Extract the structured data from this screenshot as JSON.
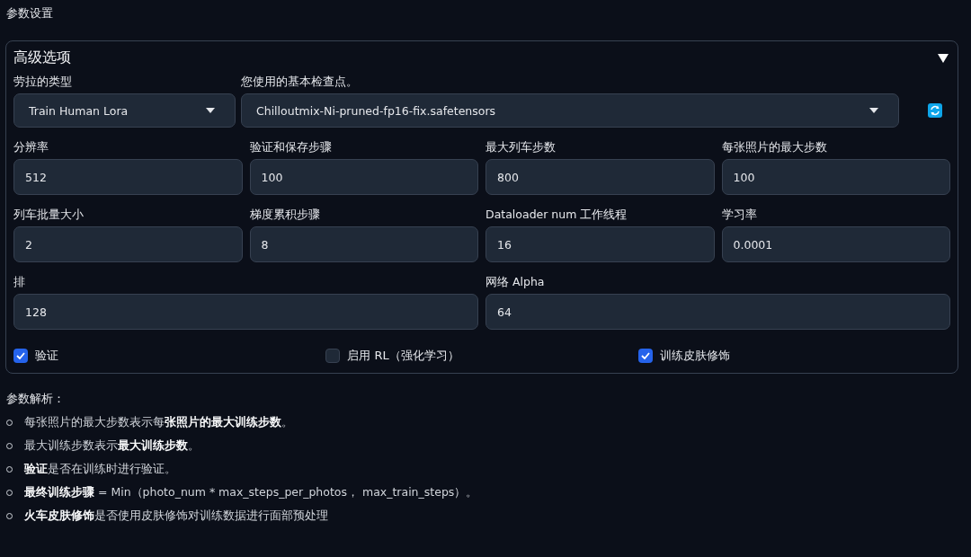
{
  "page_title": "参数设置",
  "panel": {
    "title": "高级选项",
    "expanded": true,
    "dropdowns": [
      {
        "label": "劳拉的类型",
        "value": "Train Human Lora"
      },
      {
        "label": "您使用的基本检查点。",
        "value": "Chilloutmix-Ni-pruned-fp16-fix.safetensors"
      }
    ],
    "field_rows": [
      [
        {
          "label": "分辨率",
          "value": "512"
        },
        {
          "label": "验证和保存步骤",
          "value": "100"
        },
        {
          "label": "最大列车步数",
          "value": "800"
        },
        {
          "label": "每张照片的最大步数",
          "value": "100"
        }
      ],
      [
        {
          "label": "列车批量大小",
          "value": "2"
        },
        {
          "label": "梯度累积步骤",
          "value": "8"
        },
        {
          "label": "Dataloader num 工作线程",
          "value": "16"
        },
        {
          "label": "学习率",
          "value": "0.0001"
        }
      ],
      [
        {
          "label": "排",
          "value": "128"
        },
        {
          "label": "网络 Alpha",
          "value": "64"
        }
      ]
    ],
    "checkboxes": [
      {
        "label": "验证",
        "checked": true
      },
      {
        "label": "启用 RL（强化学习）",
        "checked": false
      },
      {
        "label": "训练皮肤修饰",
        "checked": true
      }
    ]
  },
  "notes": {
    "title": "参数解析：",
    "items": [
      "每张照片的最大步数表示每**张照片的最大训练步数**。",
      "最大训练步数表示**最大训练步数**。",
      "**验证**是否在训练时进行验证。",
      "**最终训练步骤** = Min（photo_num * max_steps_per_photos， max_train_steps）。",
      "**火车皮肤修饰**是否使用皮肤修饰对训练数据进行面部预处理"
    ]
  }
}
